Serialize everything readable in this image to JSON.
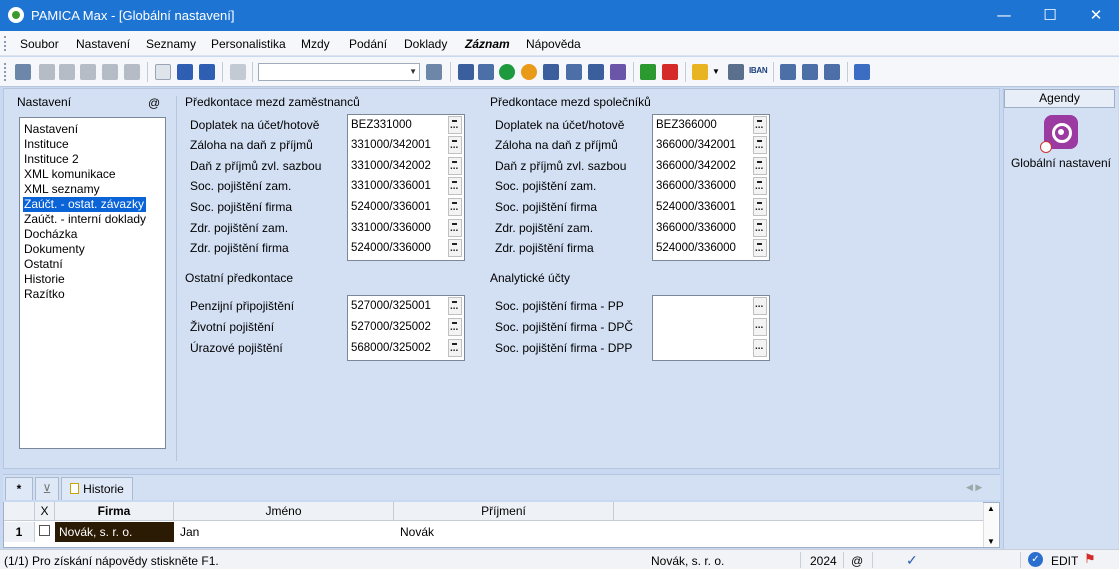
{
  "titlebar": {
    "title": "PAMICA Max - [Globální nastavení]",
    "minimize": "—",
    "maximize": "☐",
    "close": "✕"
  },
  "menu": [
    "Soubor",
    "Nastavení",
    "Seznamy",
    "Personalistika",
    "Mzdy",
    "Podání",
    "Doklady",
    "Záznam",
    "Nápověda"
  ],
  "toolbar": {
    "combo_value": "",
    "iban_label": "IBAN"
  },
  "nastaveni": {
    "header": "Nastavení",
    "at": "@",
    "items": [
      "Nastavení",
      "Instituce",
      "Instituce 2",
      "XML komunikace",
      "XML seznamy",
      "Zaúčt. - ostat. závazky",
      "Zaúčt. - interní doklady",
      "Docházka",
      "Dokumenty",
      "Ostatní",
      "Historie",
      "Razítko"
    ],
    "selected": "Zaúčt. - ostat. závazky"
  },
  "zamestnanci": {
    "title": "Předkontace mezd zaměstnanců",
    "rows": [
      {
        "label": "Doplatek na účet/hotově",
        "value": "BEZ331000"
      },
      {
        "label": "Záloha na daň z příjmů",
        "value": "331000/342001"
      },
      {
        "label": "Daň z příjmů zvl. sazbou",
        "value": "331000/342002"
      },
      {
        "label": "Soc. pojištění zam.",
        "value": "331000/336001"
      },
      {
        "label": "Soc. pojištění firma",
        "value": "524000/336001"
      },
      {
        "label": "Zdr. pojištění zam.",
        "value": "331000/336000"
      },
      {
        "label": "Zdr. pojištění firma",
        "value": "524000/336000"
      }
    ]
  },
  "spolecnici": {
    "title": "Předkontace mezd společníků",
    "rows": [
      {
        "label": "Doplatek na účet/hotově",
        "value": "BEZ366000"
      },
      {
        "label": "Záloha na daň z příjmů",
        "value": "366000/342001"
      },
      {
        "label": "Daň z příjmů zvl. sazbou",
        "value": "366000/342002"
      },
      {
        "label": "Soc. pojištění zam.",
        "value": "366000/336000"
      },
      {
        "label": "Soc. pojištění firma",
        "value": "524000/336001"
      },
      {
        "label": "Zdr. pojištění zam.",
        "value": "366000/336000"
      },
      {
        "label": "Zdr. pojištění firma",
        "value": "524000/336000"
      }
    ]
  },
  "ostatni": {
    "title": "Ostatní předkontace",
    "rows": [
      {
        "label": "Penzijní připojištění",
        "value": "527000/325001"
      },
      {
        "label": "Životní pojištění",
        "value": "527000/325002"
      },
      {
        "label": "Úrazové pojištění",
        "value": "568000/325002"
      }
    ]
  },
  "analyticke": {
    "title": "Analytické účty",
    "rows": [
      {
        "label": "Soc. pojištění firma - PP",
        "value": ""
      },
      {
        "label": "Soc. pojištění firma - DPČ",
        "value": ""
      },
      {
        "label": "Soc. pojištění firma - DPP",
        "value": ""
      }
    ]
  },
  "sidebar": {
    "header": "Agendy",
    "item_label": "Globální nastavení"
  },
  "tabs": {
    "star": "*",
    "filter": "⊻",
    "historie": "Historie"
  },
  "grid": {
    "columns": [
      "X",
      "Firma",
      "Jméno",
      "Příjmení"
    ],
    "rows": [
      {
        "num": "1",
        "firma": "Novák, s. r. o.",
        "jmeno": "Jan",
        "prijmeni": "Novák"
      }
    ]
  },
  "status": {
    "help": "(1/1) Pro získání nápovědy stiskněte F1.",
    "company": "Novák, s. r. o.",
    "year": "2024",
    "at": "@",
    "mode": "EDIT"
  },
  "colors": {
    "titlebar": "#1e74d3",
    "selection": "#0a64d8",
    "panel": "#d3e0f4"
  }
}
